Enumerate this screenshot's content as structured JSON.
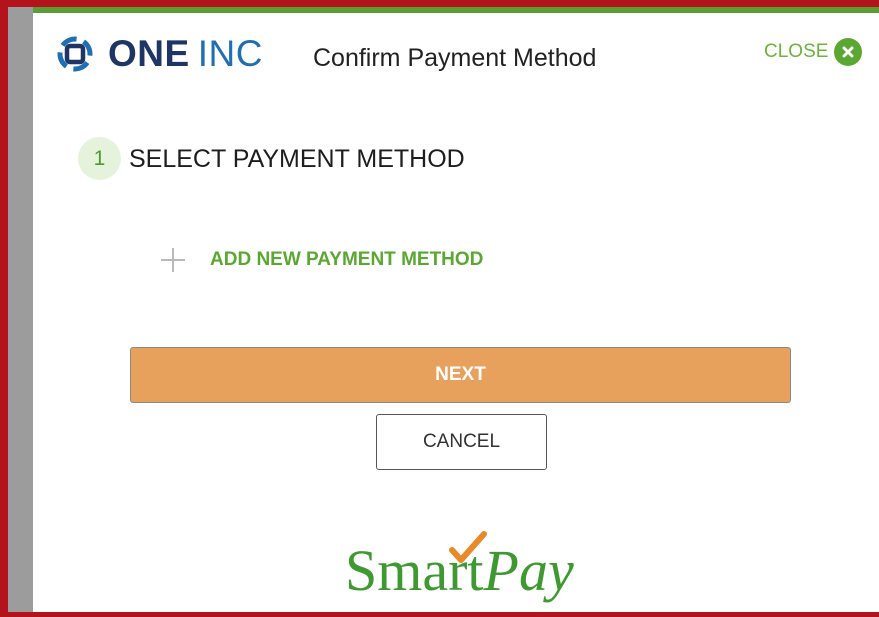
{
  "header": {
    "logo_one": "ONE",
    "logo_inc": "INC",
    "title": "Confirm Payment Method",
    "close_label": "CLOSE"
  },
  "step": {
    "number": "1",
    "title": "SELECT PAYMENT METHOD"
  },
  "add_payment": {
    "label": "ADD NEW PAYMENT METHOD"
  },
  "buttons": {
    "next": "NEXT",
    "cancel": "CANCEL"
  },
  "footer_logo": {
    "smart": "Smart",
    "pay": "Pay"
  },
  "colors": {
    "frame_red": "#b3141b",
    "brand_green": "#5aa832",
    "next_orange": "#e8a15c",
    "logo_navy": "#1f3566",
    "logo_blue": "#1f6fb2"
  },
  "icons": [
    "one-inc-logo-icon",
    "close-icon",
    "plus-icon",
    "checkmark-icon"
  ]
}
